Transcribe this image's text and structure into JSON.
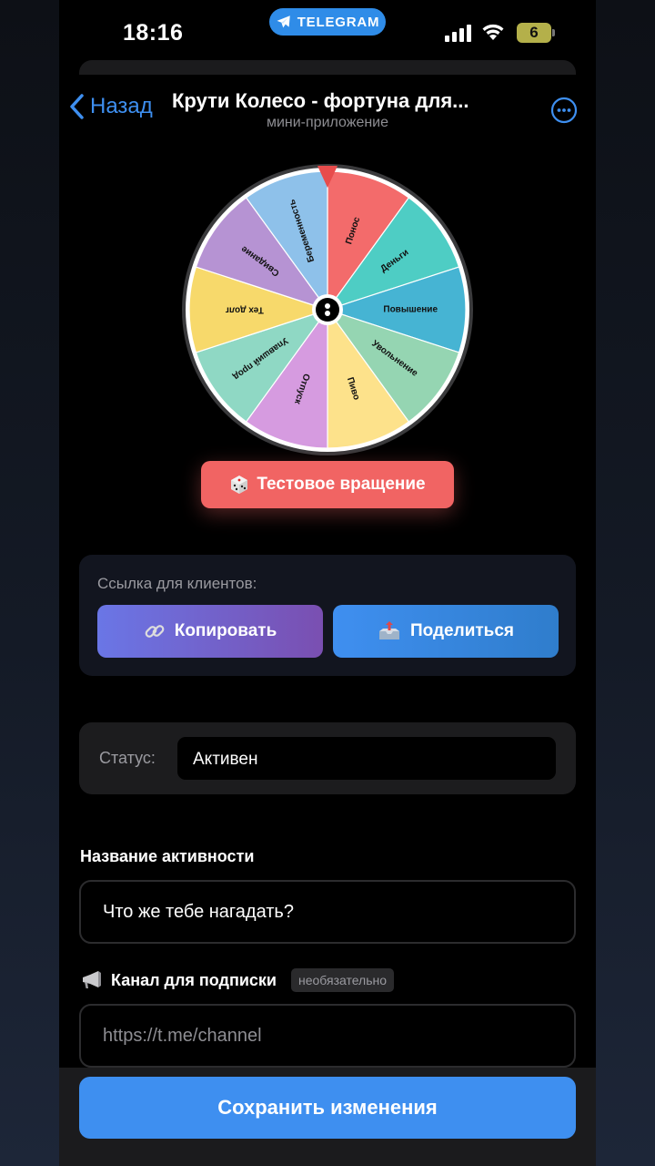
{
  "status_bar": {
    "time": "18:16",
    "telegram_label": "TELEGRAM",
    "battery": "6"
  },
  "header": {
    "back_label": "Назад",
    "title": "Крути Колесо - фортуна для...",
    "subtitle": "мини-приложение"
  },
  "wheel": {
    "segments": [
      {
        "label": "Понос",
        "color": "#f36b6b"
      },
      {
        "label": "Деньги",
        "color": "#4ecdc4"
      },
      {
        "label": "Повышение",
        "color": "#46b4d3"
      },
      {
        "label": "Увольнение",
        "color": "#95d5b2"
      },
      {
        "label": "Пиво",
        "color": "#fde28b"
      },
      {
        "label": "Отпуск",
        "color": "#d69be0"
      },
      {
        "label": "Упавший прод",
        "color": "#8fd8c4"
      },
      {
        "label": "Тех долг",
        "color": "#f7d96b"
      },
      {
        "label": "Свидание",
        "color": "#b693d3"
      },
      {
        "label": "Беременность",
        "color": "#8ec1ea"
      }
    ],
    "spin_button_label": "Тестовое вращение"
  },
  "link_card": {
    "label": "Ссылка для клиентов:",
    "copy_label": "Копировать",
    "share_label": "Поделиться"
  },
  "status": {
    "label": "Статус:",
    "value": "Активен"
  },
  "activity": {
    "title": "Название активности",
    "value": "Что же тебе нагадать?"
  },
  "channel": {
    "title": "Канал для подписки",
    "optional": "необязательно",
    "placeholder": "https://t.me/channel"
  },
  "save_label": "Сохранить изменения",
  "colors": {
    "accent": "#3e8ff0",
    "spin": "#f16463"
  }
}
